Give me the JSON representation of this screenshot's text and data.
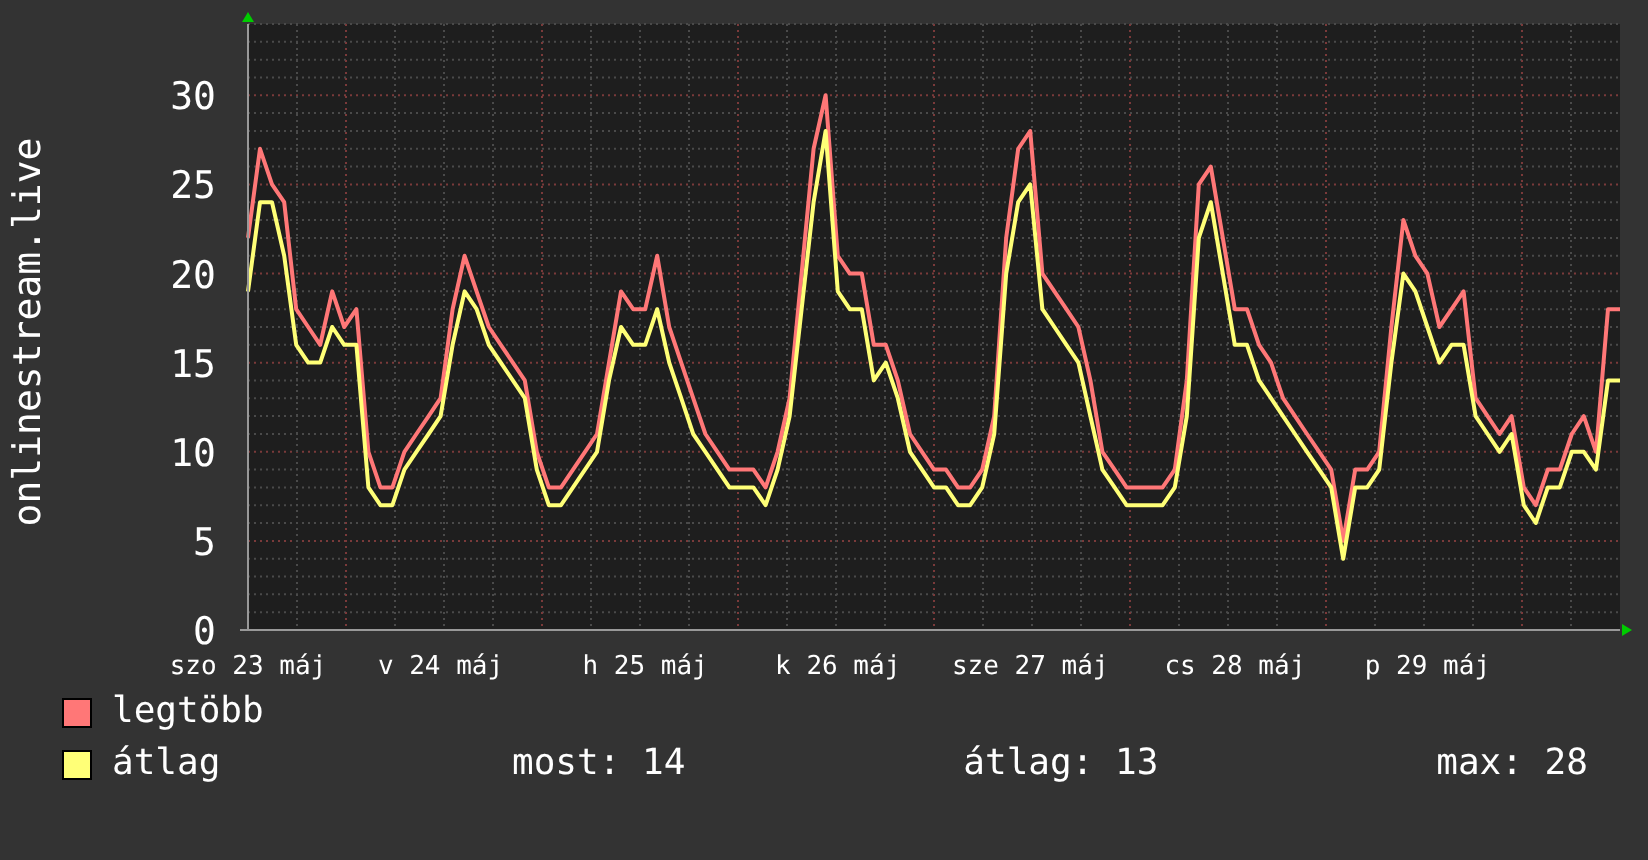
{
  "chart": {
    "chart_data": {
      "type": "line",
      "ylabel": "onlinestream.live",
      "grid": true,
      "ylim": [
        0,
        34
      ],
      "categories": [
        "szo 23 máj",
        null,
        null,
        null,
        null,
        null,
        null,
        null,
        null,
        null,
        null,
        null,
        null,
        null,
        null,
        null,
        "v 24 máj",
        null,
        null,
        null,
        null,
        null,
        null,
        null,
        null,
        null,
        null,
        null,
        null,
        null,
        null,
        null,
        null,
        "h 25 máj",
        null,
        null,
        null,
        null,
        null,
        null,
        null,
        null,
        null,
        null,
        null,
        null,
        null,
        null,
        null,
        "k 26 máj",
        null,
        null,
        null,
        null,
        null,
        null,
        null,
        null,
        null,
        null,
        null,
        null,
        null,
        null,
        null,
        "sze 27 máj",
        null,
        null,
        null,
        null,
        null,
        null,
        null,
        null,
        null,
        null,
        null,
        null,
        null,
        null,
        null,
        null,
        "cs 28 máj",
        null,
        null,
        null,
        null,
        null,
        null,
        null,
        null,
        null,
        null,
        null,
        null,
        null,
        null,
        null,
        "p 29 máj",
        null,
        null,
        null,
        null,
        null,
        null,
        null,
        null,
        null,
        null,
        null,
        null,
        null,
        null,
        null,
        null
      ],
      "yticks": [
        0,
        5,
        10,
        15,
        20,
        25,
        30
      ],
      "series": [
        {
          "name": "legtöbb",
          "color": "#ff7777",
          "values": [
            22,
            27,
            25,
            24,
            18,
            17,
            16,
            19,
            17,
            18,
            10,
            8,
            8,
            10,
            11,
            12,
            13,
            18,
            21,
            19,
            17,
            16,
            15,
            14,
            10,
            8,
            8,
            9,
            10,
            11,
            15,
            19,
            18,
            18,
            21,
            17,
            15,
            13,
            11,
            10,
            9,
            9,
            9,
            8,
            10,
            13,
            20,
            27,
            30,
            21,
            20,
            20,
            16,
            16,
            14,
            11,
            10,
            9,
            9,
            8,
            8,
            9,
            12,
            22,
            27,
            28,
            20,
            19,
            18,
            17,
            14,
            10,
            9,
            8,
            8,
            8,
            8,
            9,
            14,
            25,
            26,
            22,
            18,
            18,
            16,
            15,
            13,
            12,
            11,
            10,
            9,
            5,
            9,
            9,
            10,
            17,
            23,
            21,
            20,
            17,
            18,
            19,
            13,
            12,
            11,
            12,
            8,
            7,
            9,
            9,
            11,
            12,
            10,
            18,
            18
          ]
        },
        {
          "name": "átlag",
          "color": "#ffff77",
          "values": [
            19,
            24,
            24,
            21,
            16,
            15,
            15,
            17,
            16,
            16,
            8,
            7,
            7,
            9,
            10,
            11,
            12,
            16,
            19,
            18,
            16,
            15,
            14,
            13,
            9,
            7,
            7,
            8,
            9,
            10,
            14,
            17,
            16,
            16,
            18,
            15,
            13,
            11,
            10,
            9,
            8,
            8,
            8,
            7,
            9,
            12,
            18,
            24,
            28,
            19,
            18,
            18,
            14,
            15,
            13,
            10,
            9,
            8,
            8,
            7,
            7,
            8,
            11,
            20,
            24,
            25,
            18,
            17,
            16,
            15,
            12,
            9,
            8,
            7,
            7,
            7,
            7,
            8,
            12,
            22,
            24,
            20,
            16,
            16,
            14,
            13,
            12,
            11,
            10,
            9,
            8,
            4,
            8,
            8,
            9,
            15,
            20,
            19,
            17,
            15,
            16,
            16,
            12,
            11,
            10,
            11,
            7,
            6,
            8,
            8,
            10,
            10,
            9,
            14,
            14
          ]
        }
      ]
    }
  },
  "stats": [
    "most: 14",
    "átlag: 13",
    "max: 28"
  ]
}
